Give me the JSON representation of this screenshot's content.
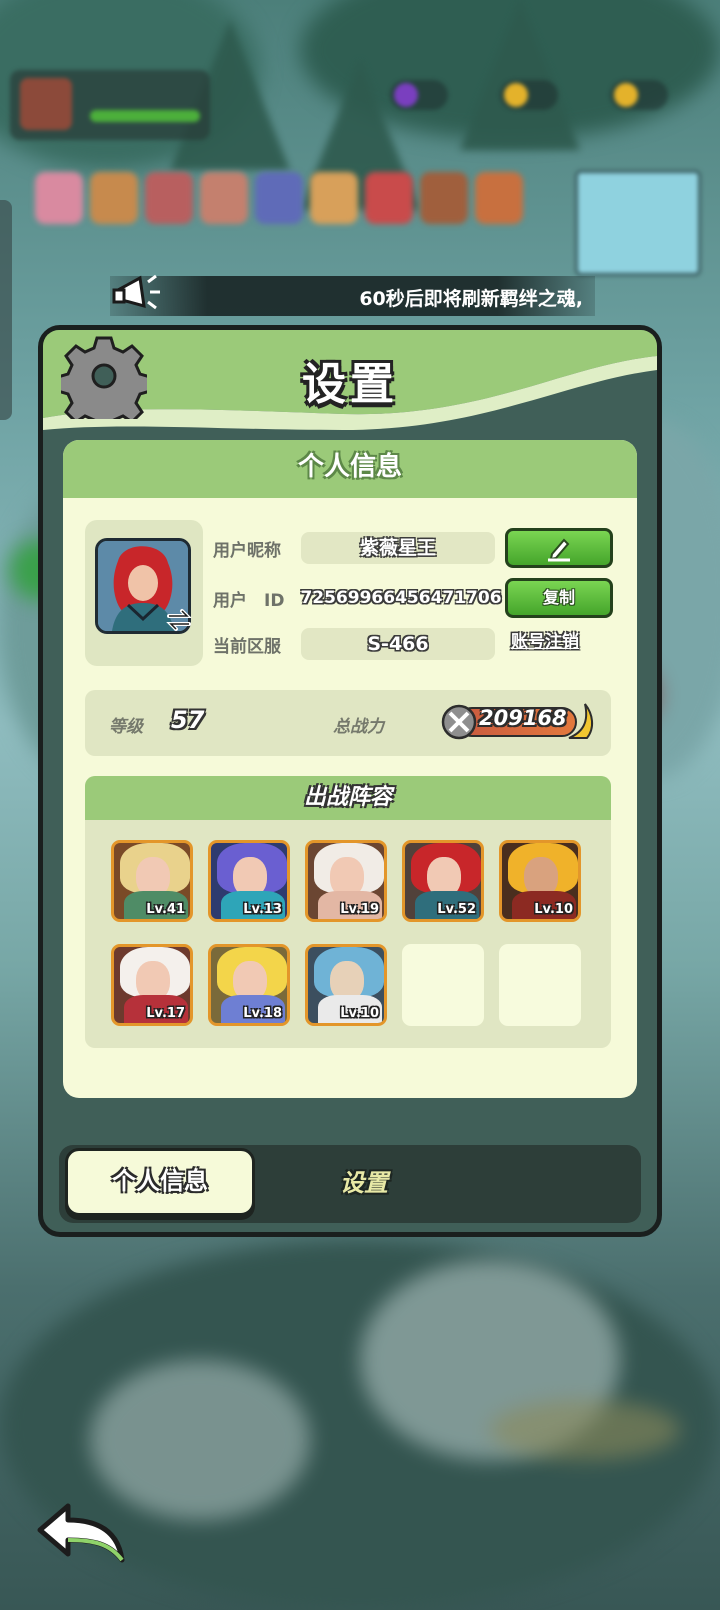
{
  "notice": {
    "text": "60秒后即将刷新羁绊之魂,"
  },
  "panel": {
    "title": "设置"
  },
  "profile": {
    "section_title": "个人信息",
    "nickname_label": "用户昵称",
    "nickname": "紫薇星王",
    "id_label": "用户　ID",
    "user_id": "72569966456471706",
    "server_label": "当前区服",
    "server": "S-466",
    "copy_button": "复制",
    "edit_icon": "pencil-icon",
    "logout_link": "账号注销"
  },
  "stats": {
    "level_label": "等级",
    "level": "57",
    "power_label": "总战力",
    "power": "209168"
  },
  "lineup": {
    "title": "出战阵容",
    "heroes": [
      {
        "level": "Lv.41"
      },
      {
        "level": "Lv.13"
      },
      {
        "level": "Lv.19"
      },
      {
        "level": "Lv.52"
      },
      {
        "level": "Lv.10"
      },
      {
        "level": "Lv.17"
      },
      {
        "level": "Lv.18"
      },
      {
        "level": "Lv.10"
      }
    ],
    "empty_slots": 2
  },
  "tabs": {
    "active": "个人信息",
    "inactive": "设置"
  },
  "colors": {
    "panel_green": "#9bca79",
    "card_bg": "#f6fad9",
    "button_green": "#45a52b",
    "hero_border": "#e3962a"
  }
}
